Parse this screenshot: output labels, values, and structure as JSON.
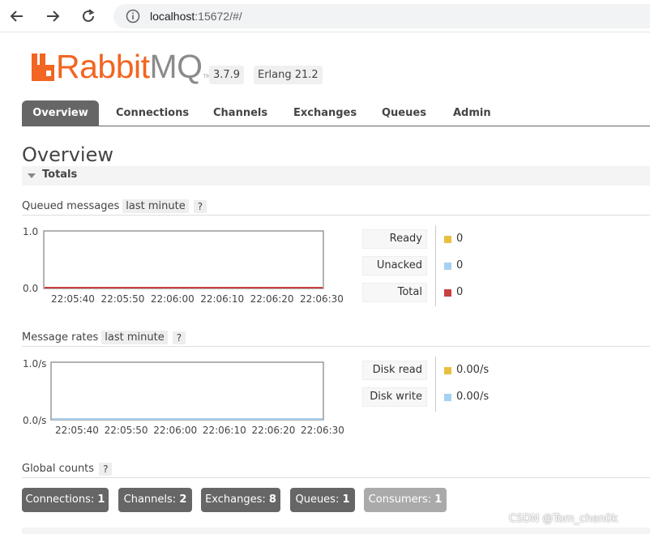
{
  "browser": {
    "url_host": "localhost",
    "url_rest": ":15672/#/"
  },
  "logo": {
    "rabbit": "Rabbit",
    "mq": "MQ",
    "tm": "TM"
  },
  "versions": {
    "rabbitmq": "3.7.9",
    "erlang": "Erlang 21.2"
  },
  "tabs": [
    {
      "label": "Overview",
      "active": true
    },
    {
      "label": "Connections"
    },
    {
      "label": "Channels"
    },
    {
      "label": "Exchanges"
    },
    {
      "label": "Queues"
    },
    {
      "label": "Admin"
    }
  ],
  "page_title": "Overview",
  "totals_label": "Totals",
  "queued": {
    "title": "Queued messages",
    "range": "last minute",
    "help": "?",
    "y_max_label": "1.0",
    "y_min_label": "0.0",
    "x_labels": [
      "22:05:40",
      "22:05:50",
      "22:06:00",
      "22:06:10",
      "22:06:20",
      "22:06:30"
    ],
    "legend": [
      {
        "label": "Ready",
        "value": "0",
        "color": "#e8c040"
      },
      {
        "label": "Unacked",
        "value": "0",
        "color": "#a7d1f0"
      },
      {
        "label": "Total",
        "value": "0",
        "color": "#c94040"
      }
    ]
  },
  "rates": {
    "title": "Message rates",
    "range": "last minute",
    "help": "?",
    "y_max_label": "1.0/s",
    "y_min_label": "0.0/s",
    "x_labels": [
      "22:05:40",
      "22:05:50",
      "22:06:00",
      "22:06:10",
      "22:06:20",
      "22:06:30"
    ],
    "legend": [
      {
        "label": "Disk read",
        "value": "0.00/s",
        "color": "#e8c040"
      },
      {
        "label": "Disk write",
        "value": "0.00/s",
        "color": "#a7d1f0"
      }
    ]
  },
  "global": {
    "title": "Global counts",
    "help": "?",
    "counts": [
      {
        "label": "Connections:",
        "value": "1"
      },
      {
        "label": "Channels:",
        "value": "2"
      },
      {
        "label": "Exchanges:",
        "value": "8"
      },
      {
        "label": "Queues:",
        "value": "1"
      },
      {
        "label": "Consumers:",
        "value": "1"
      }
    ]
  },
  "watermark": "CSDN @Tom_chen0k",
  "chart_data": [
    {
      "type": "line",
      "ylim": [
        0,
        1
      ],
      "x": [
        "22:05:40",
        "22:05:50",
        "22:06:00",
        "22:06:10",
        "22:06:20",
        "22:06:30"
      ],
      "series": [
        {
          "name": "Ready",
          "values": [
            0,
            0,
            0,
            0,
            0,
            0
          ]
        },
        {
          "name": "Unacked",
          "values": [
            0,
            0,
            0,
            0,
            0,
            0
          ]
        },
        {
          "name": "Total",
          "values": [
            0,
            0,
            0,
            0,
            0,
            0
          ]
        }
      ]
    },
    {
      "type": "line",
      "ylim": [
        0,
        1
      ],
      "x": [
        "22:05:40",
        "22:05:50",
        "22:06:00",
        "22:06:10",
        "22:06:20",
        "22:06:30"
      ],
      "series": [
        {
          "name": "Disk read",
          "values": [
            0,
            0,
            0,
            0,
            0,
            0
          ]
        },
        {
          "name": "Disk write",
          "values": [
            0,
            0,
            0,
            0,
            0,
            0
          ]
        }
      ]
    }
  ]
}
